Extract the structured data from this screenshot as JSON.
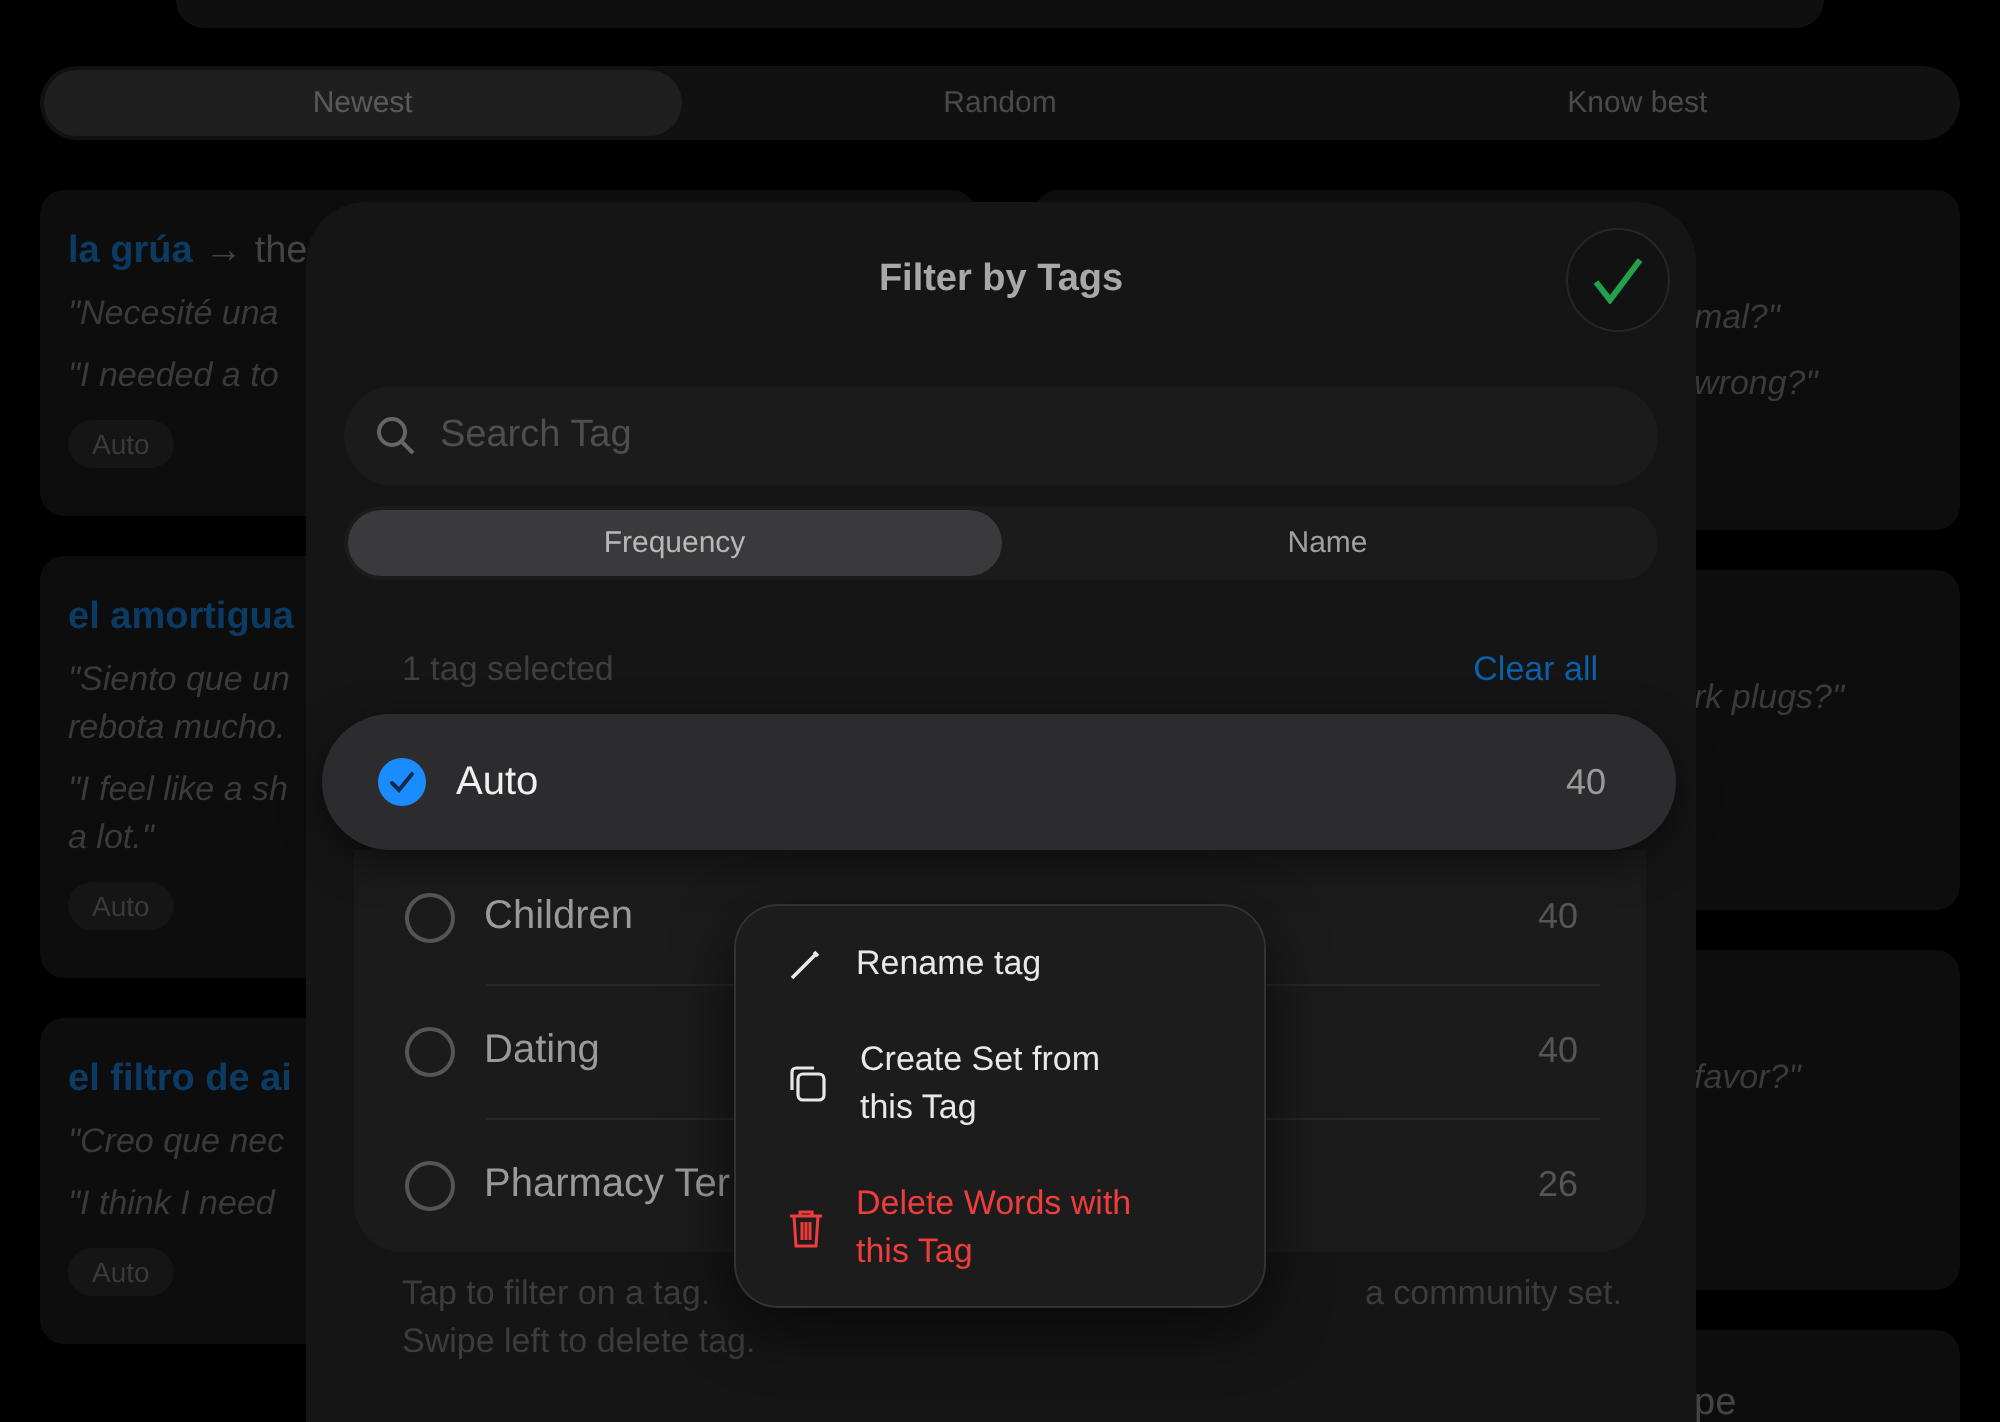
{
  "background": {
    "sort_tabs": [
      {
        "label": "Newest",
        "selected": true
      },
      {
        "label": "Random",
        "selected": false
      },
      {
        "label": "Know best",
        "selected": false
      }
    ],
    "left_cards": [
      {
        "term": "la grúa",
        "arrow": "→",
        "gloss": "the",
        "examples": [
          "\"Necesité una",
          "\"I needed a to"
        ],
        "tag": "Auto"
      },
      {
        "term": "el amortigua",
        "examples": [
          "\"Siento que un\nrebota mucho.",
          "\"I feel like a sh\na lot.\""
        ],
        "tag": "Auto"
      },
      {
        "term": "el filtro de ai",
        "examples": [
          "\"Creo que nec",
          "\"I think I need"
        ],
        "tag": "Auto"
      }
    ],
    "right_cards": [
      {
        "lines": [
          {
            "kind": "example",
            "text": "mal?\""
          },
          {
            "kind": "example",
            "text": "wrong?\""
          }
        ]
      },
      {
        "lines": [
          {
            "kind": "example",
            "text": "rk plugs?\""
          }
        ]
      },
      {
        "lines": [
          {
            "kind": "example",
            "text": "favor?\""
          }
        ]
      },
      {
        "lines": [
          {
            "kind": "title",
            "text": "pe"
          }
        ]
      }
    ]
  },
  "dialog": {
    "title": "Filter by Tags",
    "search": {
      "placeholder": "Search Tag"
    },
    "sort_tabs": [
      {
        "label": "Frequency",
        "selected": true
      },
      {
        "label": "Name",
        "selected": false
      }
    ],
    "selection_summary": "1 tag selected",
    "clear_label": "Clear all",
    "tags": [
      {
        "name": "Auto",
        "count": "40",
        "checked": true,
        "lifted": true
      },
      {
        "name": "Children",
        "count": "40",
        "checked": false,
        "lifted": false
      },
      {
        "name": "Dating",
        "count": "40",
        "checked": false,
        "lifted": false
      },
      {
        "name": "Pharmacy Ter",
        "count": "26",
        "checked": false,
        "lifted": false
      }
    ],
    "footer": {
      "line_1_start": "Tap to filter on a tag.",
      "line_1_end": "a community set.",
      "line_2": "Swipe left to delete tag."
    }
  },
  "context_menu": [
    {
      "kind": "normal",
      "lines": [
        "Rename tag"
      ]
    },
    {
      "kind": "normal",
      "lines": [
        "Create Set from",
        "this Tag"
      ]
    },
    {
      "kind": "destructive",
      "lines": [
        "Delete Words with",
        "this Tag"
      ]
    }
  ]
}
